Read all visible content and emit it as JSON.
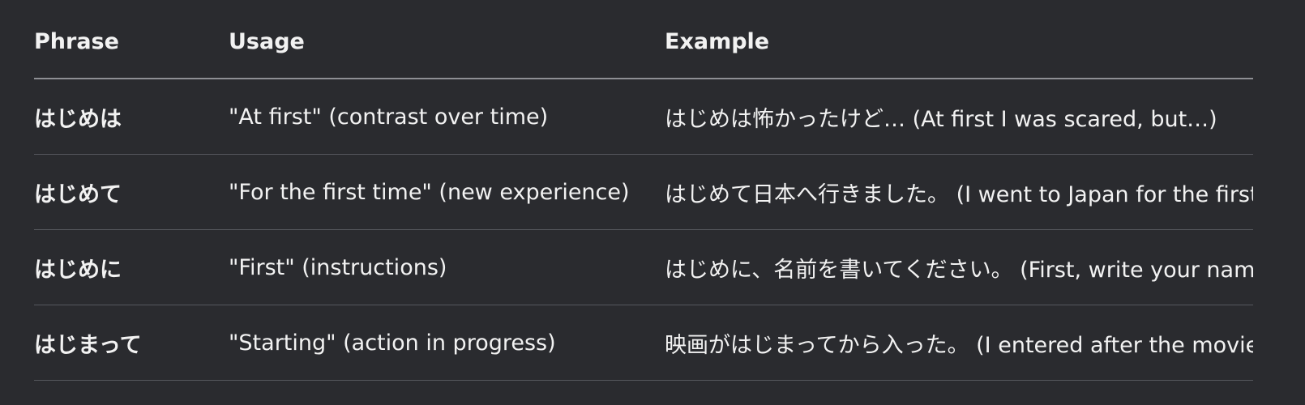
{
  "table": {
    "headers": [
      "Phrase",
      "Usage",
      "Example"
    ],
    "rows": [
      {
        "phrase": "はじめは",
        "usage": "\"At first\" (contrast over time)",
        "example": "はじめは怖かったけど… (At first I was scared, but…)"
      },
      {
        "phrase": "はじめて",
        "usage": "\"For the first time\" (new experience)",
        "example": "はじめて日本へ行きました。 (I went to Japan for the first time.)"
      },
      {
        "phrase": "はじめに",
        "usage": "\"First\" (instructions)",
        "example": "はじめに、名前を書いてください。 (First, write your name.)"
      },
      {
        "phrase": "はじまって",
        "usage": "\"Starting\" (action in progress)",
        "example": "映画がはじまってから入った。 (I entered after the movie started.)"
      }
    ]
  }
}
